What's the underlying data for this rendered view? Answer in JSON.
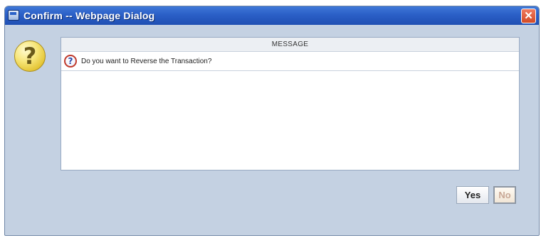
{
  "window": {
    "title": "Confirm -- Webpage Dialog",
    "close_symbol": "✕",
    "title_icon": "webpage-icon"
  },
  "dialog": {
    "icon": "question-icon",
    "icon_glyph": "?",
    "panel": {
      "header": "MESSAGE",
      "message_icon_glyph": "?",
      "message": "Do you want to Reverse the Transaction?"
    },
    "buttons": {
      "yes_label": "Yes",
      "no_label": "No"
    }
  }
}
